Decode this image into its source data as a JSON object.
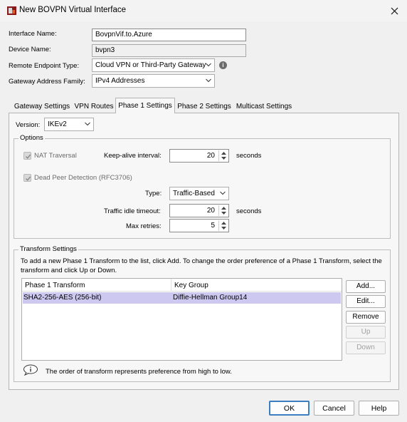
{
  "window": {
    "title": "New BOVPN Virtual Interface"
  },
  "form": {
    "interface_name_label": "Interface Name:",
    "interface_name_value": "BovpnVif.to.Azure",
    "device_name_label": "Device Name:",
    "device_name_value": "bvpn3",
    "remote_endpoint_label": "Remote Endpoint Type:",
    "remote_endpoint_value": "Cloud VPN or Third-Party Gateway",
    "gateway_family_label": "Gateway Address Family:",
    "gateway_family_value": "IPv4 Addresses"
  },
  "tabs": [
    {
      "label": "Gateway Settings"
    },
    {
      "label": "VPN Routes"
    },
    {
      "label": "Phase 1 Settings",
      "active": true
    },
    {
      "label": "Phase 2 Settings"
    },
    {
      "label": "Multicast Settings"
    }
  ],
  "phase1": {
    "version_label": "Version:",
    "version_value": "IKEv2",
    "options_title": "Options",
    "nat_traversal_label": "NAT Traversal",
    "keepalive_label": "Keep-alive interval:",
    "keepalive_value": "20",
    "seconds_label": "seconds",
    "dpd_label": "Dead Peer Detection (RFC3706)",
    "type_label": "Type:",
    "type_value": "Traffic-Based",
    "idle_timeout_label": "Traffic idle timeout:",
    "idle_timeout_value": "20",
    "max_retries_label": "Max retries:",
    "max_retries_value": "5"
  },
  "transform": {
    "title": "Transform Settings",
    "description": "To add a new Phase 1 Transform to the list, click Add. To change the order preference of a Phase 1 Transform, select the transform and click Up or Down.",
    "columns": [
      "Phase 1 Transform",
      "Key Group"
    ],
    "rows": [
      {
        "transform": "SHA2-256-AES (256-bit)",
        "key_group": "Diffie-Hellman Group14"
      }
    ],
    "buttons": {
      "add": "Add...",
      "edit": "Edit...",
      "remove": "Remove",
      "up": "Up",
      "down": "Down"
    },
    "note": "The order of transform represents preference from high to low."
  },
  "footer": {
    "ok": "OK",
    "cancel": "Cancel",
    "help": "Help"
  },
  "colors": {
    "selection": "#ccc8f0",
    "primary_border": "#3c7fc0"
  }
}
